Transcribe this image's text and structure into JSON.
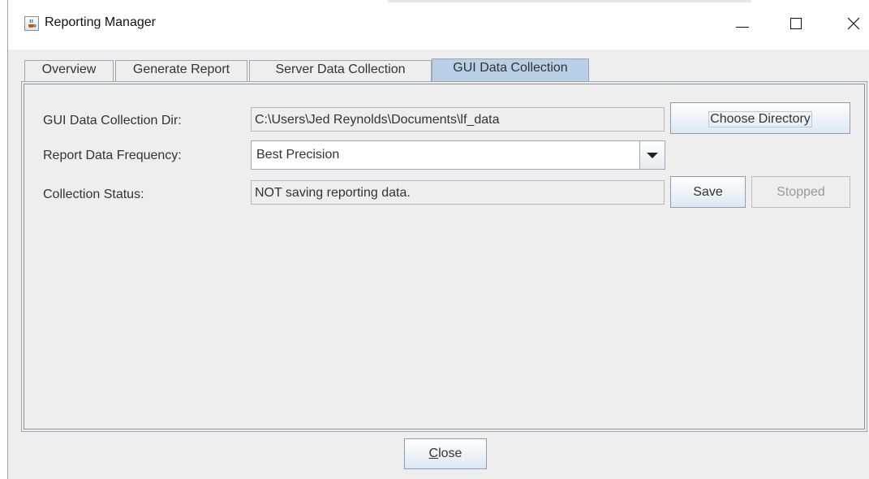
{
  "window": {
    "title": "Reporting Manager"
  },
  "tabs": [
    {
      "label": "Overview"
    },
    {
      "label": "Generate Report"
    },
    {
      "label": "Server Data Collection"
    },
    {
      "label": "GUI Data Collection"
    }
  ],
  "selected_tab": "GUI Data Collection",
  "gui_data_collection": {
    "dir_label": "GUI Data Collection Dir:",
    "dir_value": "C:\\Users\\Jed Reynolds\\Documents\\lf_data",
    "choose_directory_label": "Choose Directory",
    "frequency_label": "Report Data Frequency:",
    "frequency_value": "Best Precision",
    "status_label": "Collection Status:",
    "status_value": "NOT saving reporting data.",
    "save_label": "Save",
    "stopped_label": "Stopped"
  },
  "footer": {
    "close_label": "Close"
  },
  "colors": {
    "panel_background": "#eeeeee",
    "selected_tab": "#b8cfe5",
    "border": "#9fa6ad"
  },
  "icons": {
    "app": "java-coffee-icon",
    "minimize": "minimize-icon",
    "maximize": "maximize-icon",
    "close": "close-icon",
    "dropdown": "chevron-down-icon"
  }
}
